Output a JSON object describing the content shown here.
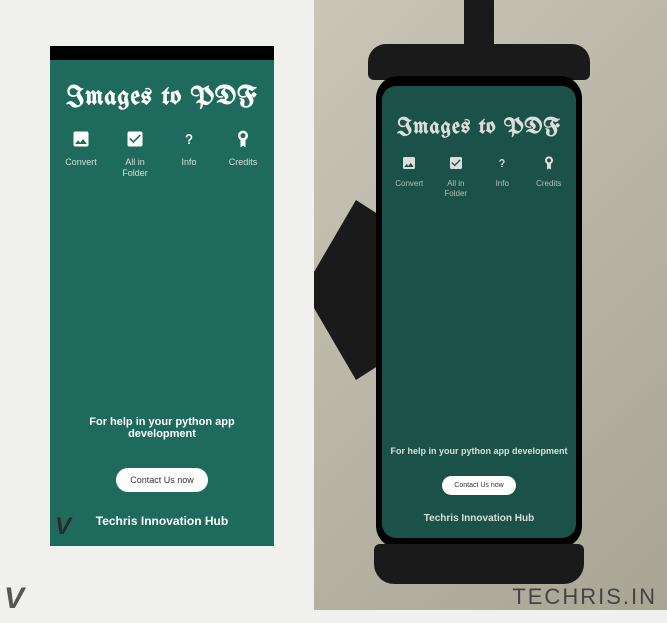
{
  "app": {
    "title": "Images to PDF",
    "nav": [
      {
        "label": "Convert"
      },
      {
        "label": "All in\nFolder"
      },
      {
        "label": "Info"
      },
      {
        "label": "Credits"
      }
    ],
    "help_text": "For help in your python app development",
    "contact_btn": "Contact Us now",
    "company": "Techris Innovation Hub"
  },
  "site_url": "TECHRIS.IN",
  "logo_glyph": "V"
}
